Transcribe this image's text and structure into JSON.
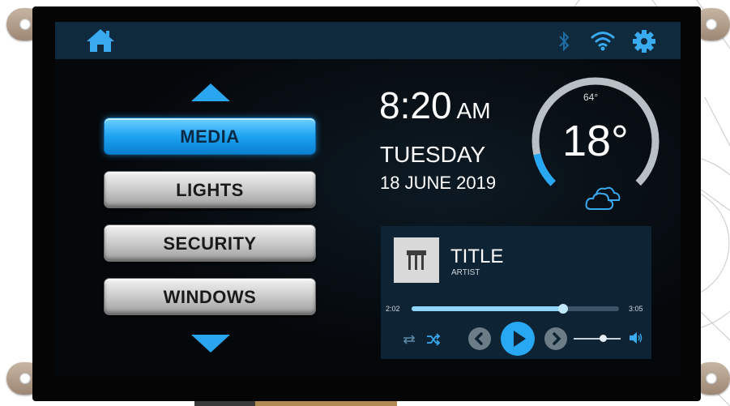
{
  "topbar": {
    "home_icon": "home-icon",
    "bluetooth_icon": "bluetooth-icon",
    "wifi_icon": "wifi-icon",
    "settings_icon": "gear-icon"
  },
  "menu": {
    "items": [
      {
        "label": "MEDIA",
        "active": true
      },
      {
        "label": "LIGHTS",
        "active": false
      },
      {
        "label": "SECURITY",
        "active": false
      },
      {
        "label": "WINDOWS",
        "active": false
      }
    ]
  },
  "clock": {
    "time": "8:20",
    "ampm": "AM",
    "day": "TUESDAY",
    "date": "18 JUNE 2019"
  },
  "thermostat": {
    "setpoint": "64°",
    "temperature": "18°",
    "weather_icon": "cloud-icon",
    "level_fraction": 0.12
  },
  "player": {
    "title": "TITLE",
    "artist": "ARTIST",
    "elapsed": "2:02",
    "total": "3:05",
    "progress_fraction": 0.73,
    "volume_fraction": 0.62
  },
  "colors": {
    "accent": "#28a8f3",
    "topbar": "#0f2a3d",
    "player_bg": "#0e2333"
  }
}
